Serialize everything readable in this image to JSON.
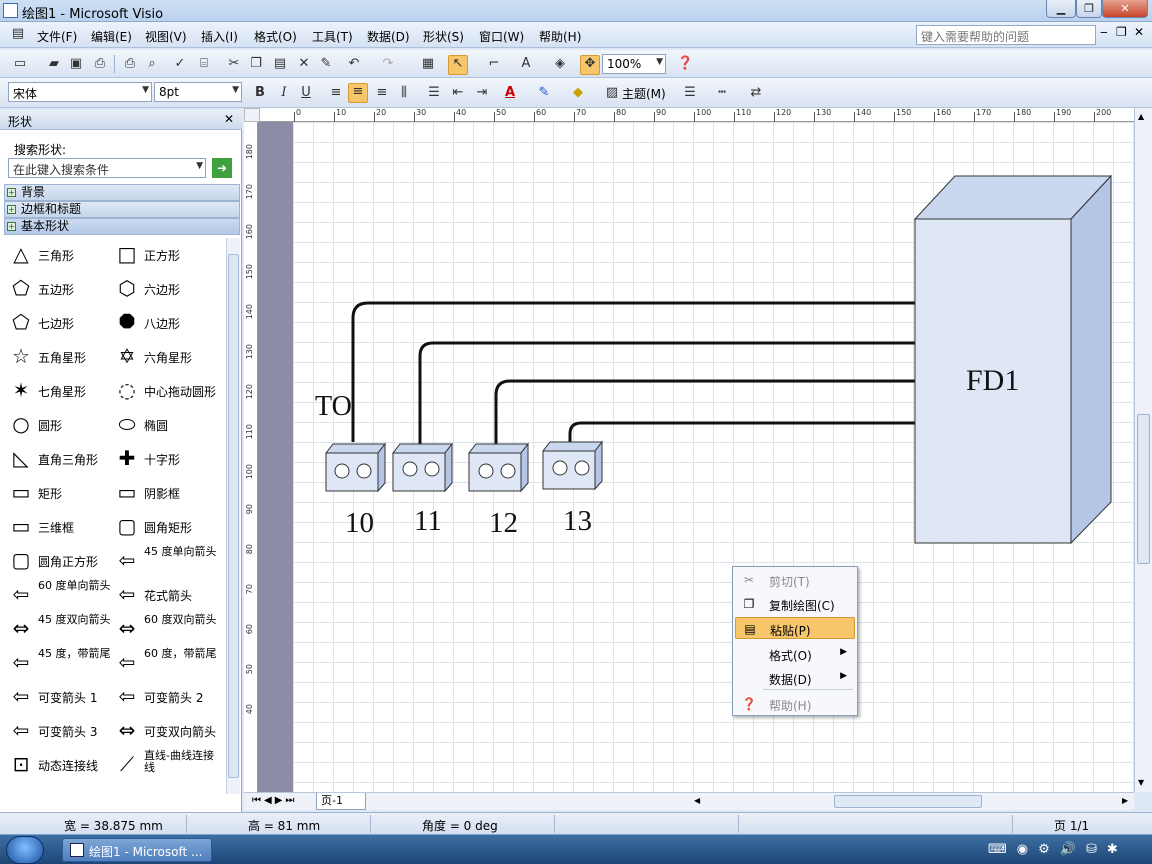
{
  "titlebar": {
    "title": "绘图1 - Microsoft Visio",
    "min": "▁",
    "max": "❐",
    "close": "✕"
  },
  "menubar": {
    "items": [
      "文件(F)",
      "编辑(E)",
      "视图(V)",
      "插入(I)",
      "格式(O)",
      "工具(T)",
      "数据(D)",
      "形状(S)",
      "窗口(W)",
      "帮助(H)"
    ],
    "help_placeholder": "键入需要帮助的问题",
    "doc_min": "‒",
    "doc_restore": "❐",
    "doc_close": "✕"
  },
  "toolbar_standard": {
    "zoom": "100%"
  },
  "toolbar_format": {
    "font": "宋体",
    "size": "8pt",
    "bold": "B",
    "italic": "I",
    "underline": "U",
    "theme": "主题(M)"
  },
  "panel": {
    "title": "形状",
    "close": "✕",
    "search_label": "搜索形状:",
    "search_placeholder": "在此键入搜索条件",
    "stencils": [
      "背景",
      "边框和标题",
      "基本形状"
    ],
    "shapes": [
      {
        "left": "三角形",
        "right": "正方形"
      },
      {
        "left": "五边形",
        "right": "六边形"
      },
      {
        "left": "七边形",
        "right": "八边形"
      },
      {
        "left": "五角星形",
        "right": "六角星形"
      },
      {
        "left": "七角星形",
        "right": "中心拖动圆形"
      },
      {
        "left": "圆形",
        "right": "椭圆"
      },
      {
        "left": "直角三角形",
        "right": "十字形"
      },
      {
        "left": "矩形",
        "right": "阴影框"
      },
      {
        "left": "三维框",
        "right": "圆角矩形"
      },
      {
        "left": "圆角正方形",
        "right": "45 度单向箭头"
      },
      {
        "left": "60 度单向箭头",
        "right": "花式箭头"
      },
      {
        "left": "45 度双向箭头",
        "right": "60 度双向箭头"
      },
      {
        "left": "45 度，带箭尾",
        "right": "60 度，带箭尾"
      },
      {
        "left": "可变箭头 1",
        "right": "可变箭头 2"
      },
      {
        "left": "可变箭头 3",
        "right": "可变双向箭头"
      },
      {
        "left": "动态连接线",
        "right": "直线-曲线连接线"
      }
    ]
  },
  "ruler_h": [
    "0",
    "10",
    "20",
    "30",
    "40",
    "50",
    "60",
    "70",
    "80",
    "90",
    "100",
    "110",
    "120",
    "130",
    "140",
    "150",
    "160",
    "170",
    "180",
    "190",
    "200"
  ],
  "ruler_v": [
    "180",
    "170",
    "160",
    "150",
    "140",
    "130",
    "120",
    "110",
    "100",
    "90",
    "80",
    "70",
    "60",
    "50",
    "40"
  ],
  "drawing": {
    "to_label": "TO",
    "outlets": [
      "10",
      "11",
      "12",
      "13"
    ],
    "fd_label": "FD1"
  },
  "context_menu": {
    "items": [
      "剪切(T)",
      "复制绘图(C)",
      "粘贴(P)",
      "格式(O)",
      "数据(D)",
      "帮助(H)"
    ]
  },
  "page_tab": "页-1",
  "statusbar": {
    "width": "宽 = 38.875 mm",
    "height": "高 = 81 mm",
    "angle": "角度 = 0 deg",
    "page": "页 1/1"
  },
  "taskbar": {
    "task": "绘图1 - Microsoft ..."
  },
  "colors": {
    "box_face": "#dfe7f6",
    "box_top": "#c9d7ef",
    "box_side": "#b4c5e6",
    "accent": "#f7c66b"
  }
}
